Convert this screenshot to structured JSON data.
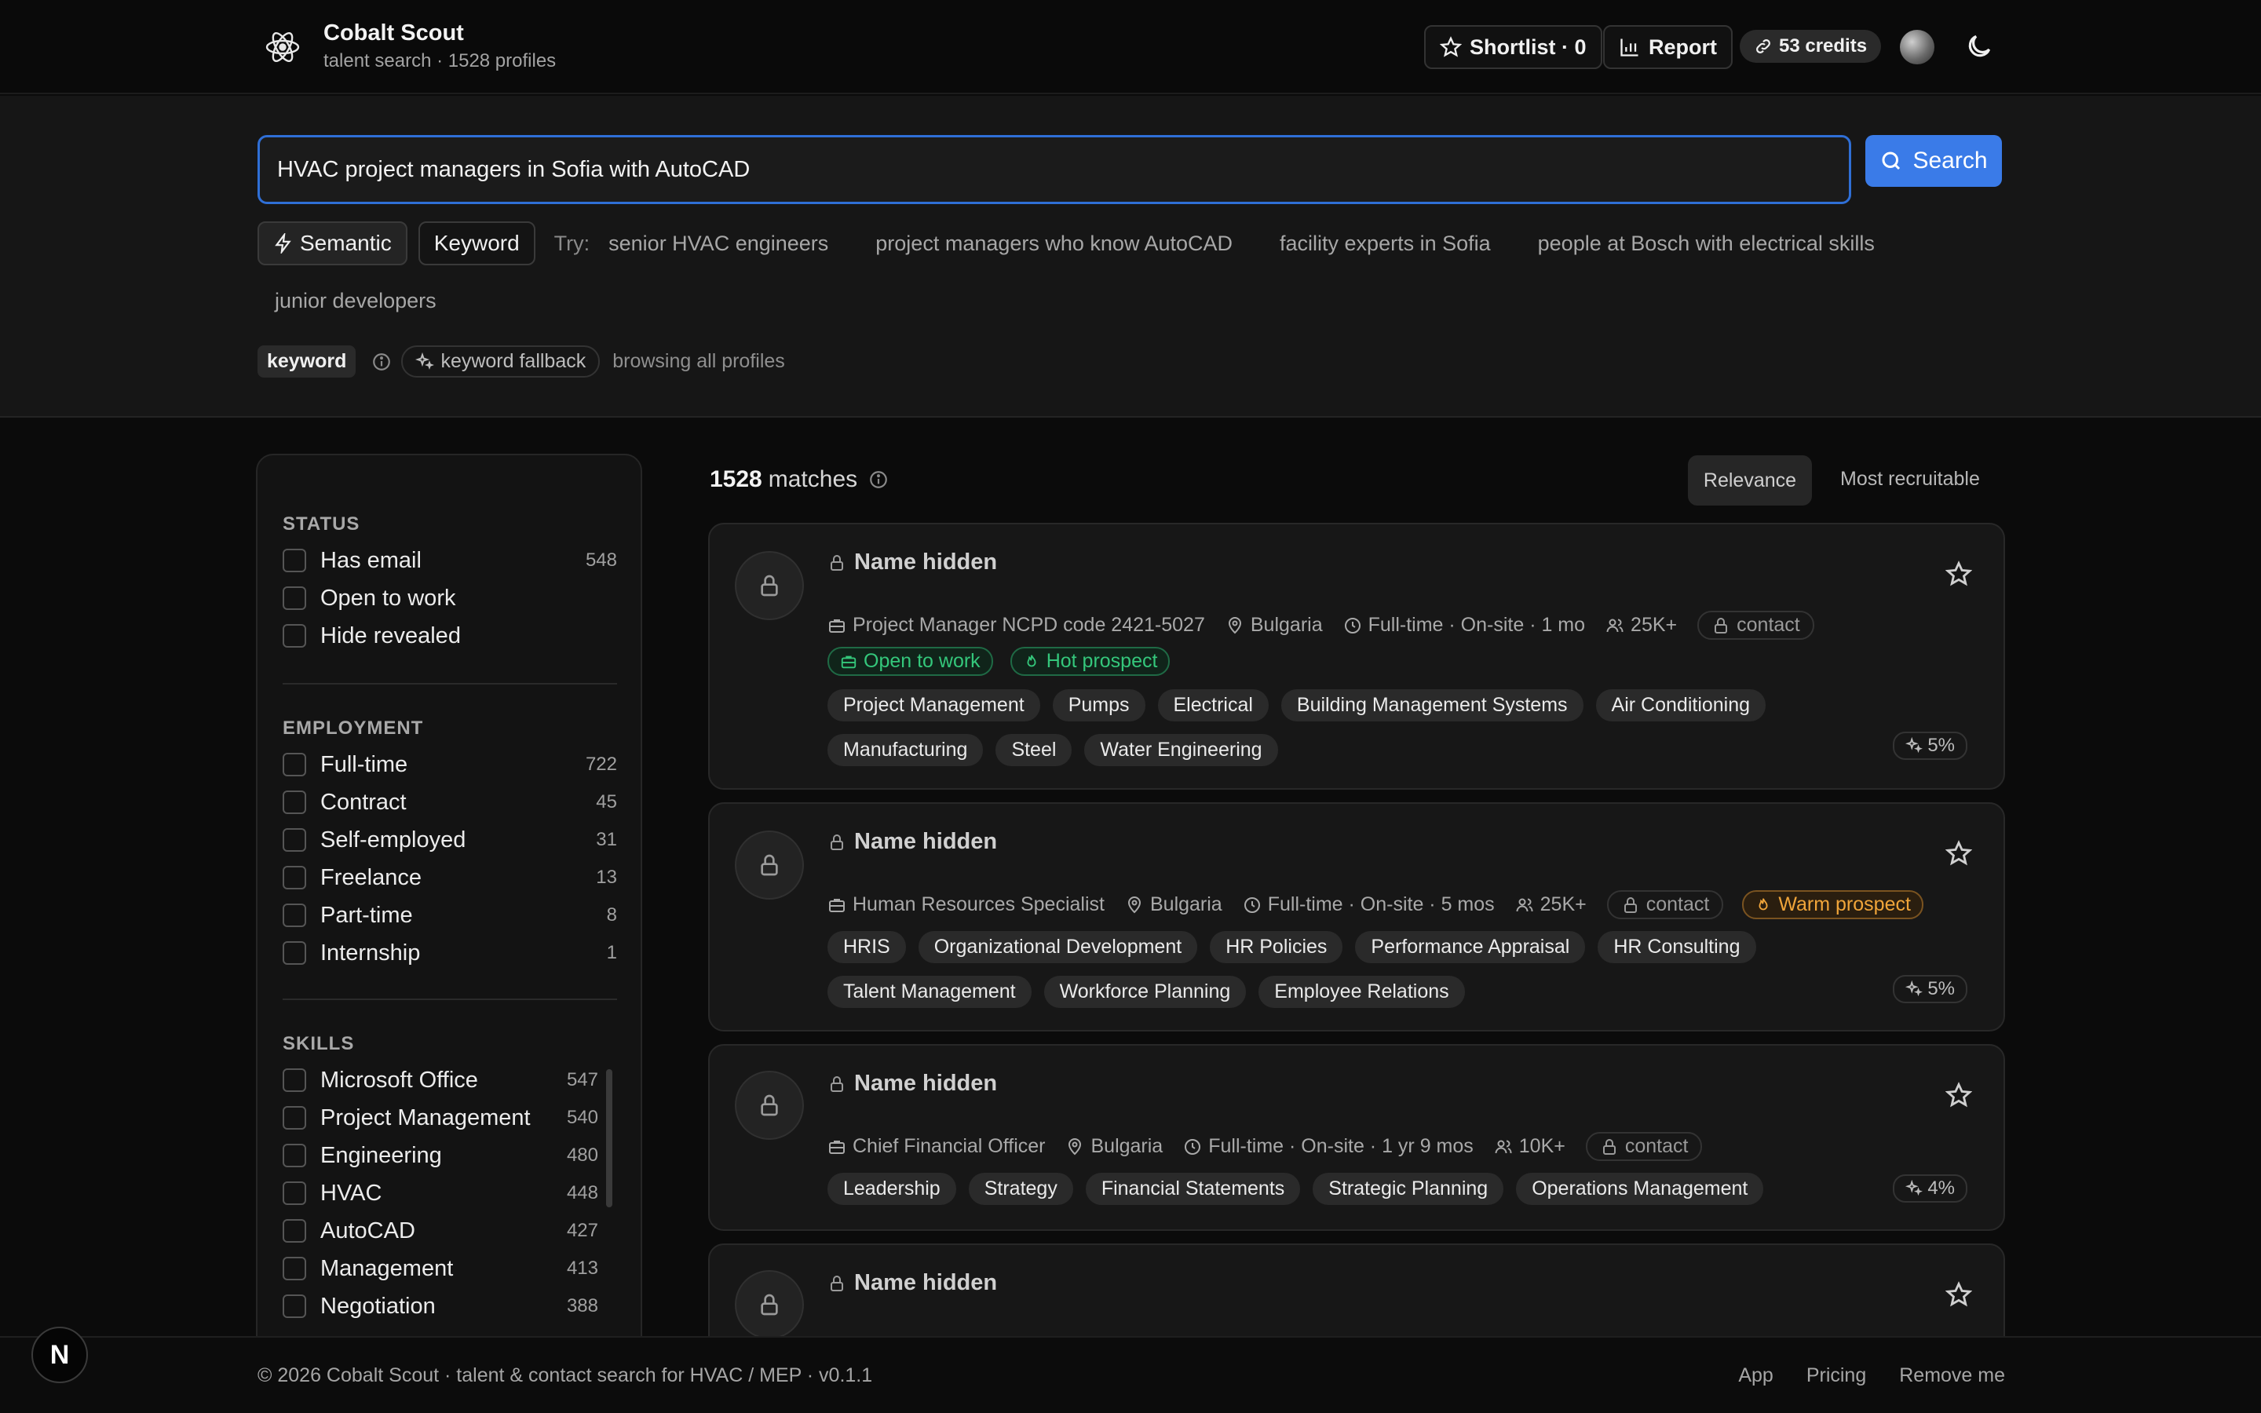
{
  "header": {
    "title": "Cobalt Scout",
    "subtitle": "talent search · 1528 profiles",
    "shortlist_label": "Shortlist · 0",
    "report_label": "Report",
    "credits_label": "53 credits"
  },
  "search": {
    "query": "HVAC project managers in Sofia with AutoCAD",
    "button_label": "Search",
    "mode_semantic": "Semantic",
    "mode_keyword": "Keyword",
    "try_label": "Try:",
    "suggestions": [
      "senior HVAC engineers",
      "project managers who know AutoCAD",
      "facility experts in Sofia",
      "people at Bosch with electrical skills",
      "junior developers"
    ],
    "keyword_pill": "keyword",
    "fallback_label": "keyword fallback",
    "browse_label": "browsing all profiles"
  },
  "filters": {
    "status": {
      "title": "STATUS",
      "items": [
        {
          "label": "Has email",
          "count": "548"
        },
        {
          "label": "Open to work",
          "count": ""
        },
        {
          "label": "Hide revealed",
          "count": ""
        }
      ]
    },
    "employment": {
      "title": "EMPLOYMENT",
      "items": [
        {
          "label": "Full-time",
          "count": "722"
        },
        {
          "label": "Contract",
          "count": "45"
        },
        {
          "label": "Self-employed",
          "count": "31"
        },
        {
          "label": "Freelance",
          "count": "13"
        },
        {
          "label": "Part-time",
          "count": "8"
        },
        {
          "label": "Internship",
          "count": "1"
        }
      ]
    },
    "skills": {
      "title": "SKILLS",
      "items": [
        {
          "label": "Microsoft Office",
          "count": "547"
        },
        {
          "label": "Project Management",
          "count": "540"
        },
        {
          "label": "Engineering",
          "count": "480"
        },
        {
          "label": "HVAC",
          "count": "448"
        },
        {
          "label": "AutoCAD",
          "count": "427"
        },
        {
          "label": "Management",
          "count": "413"
        },
        {
          "label": "Negotiation",
          "count": "388"
        }
      ]
    }
  },
  "results": {
    "count": "1528",
    "count_suffix": "matches",
    "sort_relevance": "Relevance",
    "sort_recruitable": "Most recruitable",
    "cards": [
      {
        "name": "Name hidden",
        "title": "Project Manager NCPD code 2421-5027",
        "location": "Bulgaria",
        "employment": "Full-time · On-site · 1 mo",
        "company_size": "25K+",
        "contact": "contact",
        "badges": [
          "Open to work",
          "Hot prospect"
        ],
        "skills": [
          "Project Management",
          "Pumps",
          "Electrical",
          "Building Management Systems",
          "Air Conditioning",
          "Manufacturing",
          "Steel",
          "Water Engineering"
        ],
        "score": "5%"
      },
      {
        "name": "Name hidden",
        "title": "Human Resources Specialist",
        "location": "Bulgaria",
        "employment": "Full-time · On-site · 5 mos",
        "company_size": "25K+",
        "contact": "contact",
        "badge": "Warm prospect",
        "skills": [
          "HRIS",
          "Organizational Development",
          "HR Policies",
          "Performance Appraisal",
          "HR Consulting",
          "Talent Management",
          "Workforce Planning",
          "Employee Relations"
        ],
        "score": "5%"
      },
      {
        "name": "Name hidden",
        "title": "Chief Financial Officer",
        "location": "Bulgaria",
        "employment": "Full-time · On-site · 1 yr 9 mos",
        "company_size": "10K+",
        "contact": "contact",
        "skills": [
          "Leadership",
          "Strategy",
          "Financial Statements",
          "Strategic Planning",
          "Operations Management"
        ],
        "score": "4%"
      },
      {
        "name": "Name hidden"
      }
    ]
  },
  "footer": {
    "text": "© 2026 Cobalt Scout · talent & contact search for HVAC / MEP · v0.1.1",
    "links": [
      "App",
      "Pricing",
      "Remove me"
    ]
  },
  "colors": {
    "accent": "#3a7be8",
    "green": "#34c77b",
    "orange": "#f0a53a"
  }
}
